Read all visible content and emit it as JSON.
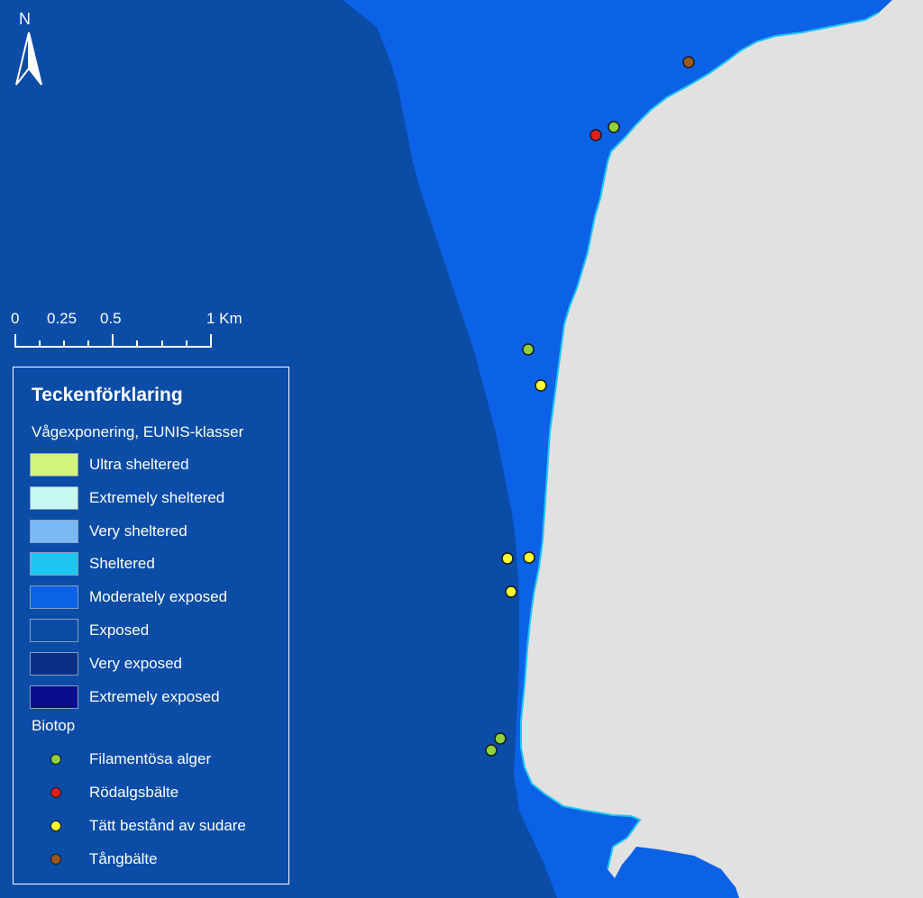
{
  "north_label": "N",
  "scale": {
    "ticks": [
      "0",
      "0.25",
      "0.5",
      "1 Km"
    ]
  },
  "legend": {
    "title": "Teckenförklaring",
    "subtitle": "Vågexponering, EUNIS-klasser",
    "classes": [
      {
        "label": "Ultra sheltered",
        "color": "#d2f57a"
      },
      {
        "label": "Extremely sheltered",
        "color": "#c6f8ef"
      },
      {
        "label": "Very sheltered",
        "color": "#7ab8f5"
      },
      {
        "label": "Sheltered",
        "color": "#1cc6f0"
      },
      {
        "label": "Moderately exposed",
        "color": "#0b62e6"
      },
      {
        "label": "Exposed",
        "color": "#0a4ca6"
      },
      {
        "label": "Very exposed",
        "color": "#0a2f86"
      },
      {
        "label": "Extremely exposed",
        "color": "#0a0c8f"
      }
    ],
    "biotop_heading": "Biotop",
    "biotopes": [
      {
        "label": "Filamentösa alger",
        "color": "#8fd13a"
      },
      {
        "label": "Rödalgsbälte",
        "color": "#e01e1e"
      },
      {
        "label": "Tätt bestånd av sudare",
        "color": "#ffff33"
      },
      {
        "label": "Tångbälte",
        "color": "#9a5a1c"
      }
    ]
  },
  "colors": {
    "land": "#e1e1e1",
    "exposed_sea": "#0a4ca6",
    "moderately_exposed_sea": "#0b62e6",
    "sheltered_fringe": "#1cc6f0"
  }
}
